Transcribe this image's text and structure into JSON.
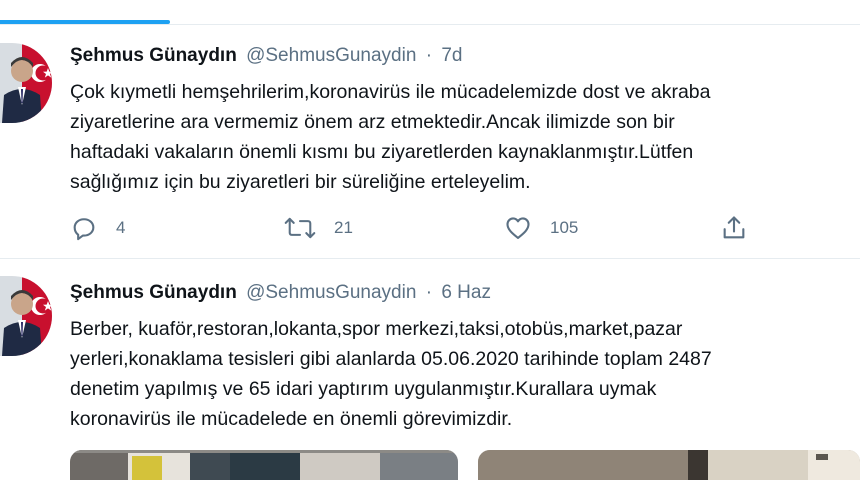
{
  "tweets": [
    {
      "name": "Şehmus Günaydın",
      "handle": "@SehmusGunaydin",
      "separator": "·",
      "time": "7d",
      "lines": [
        "Çok kıymetli hemşehrilerim,koronavirüs ile mücadelemizde dost ve akraba",
        "ziyaretlerine ara vermemiz önem arz etmektedir.Ancak  ilimizde son bir",
        "haftadaki vakaların önemli kısmı bu ziyaretlerden kaynaklanmıştır.Lütfen",
        "sağlığımız için bu ziyaretleri bir süreliğine erteleyelim."
      ],
      "replies": "4",
      "retweets": "21",
      "likes": "105"
    },
    {
      "name": "Şehmus Günaydın",
      "handle": "@SehmusGunaydin",
      "separator": "·",
      "time": "6 Haz",
      "lines": [
        "Berber, kuaför,restoran,lokanta,spor merkezi,taksi,otobüs,market,pazar",
        "yerleri,konaklama tesisleri gibi alanlarda 05.06.2020 tarihinde toplam 2487",
        "denetim yapılmış ve 65 idari yaptırım uygulanmıştır.Kurallara uymak",
        "koronavirüs ile mücadelede en önemli görevimizdir."
      ]
    }
  ],
  "icons": [
    "reply-icon",
    "retweet-icon",
    "like-icon",
    "share-icon"
  ],
  "colors": {
    "accent": "#1da1f2",
    "secondary_text": "#5b7083",
    "primary_text": "#0f1419",
    "divider": "#e6ecf0"
  }
}
